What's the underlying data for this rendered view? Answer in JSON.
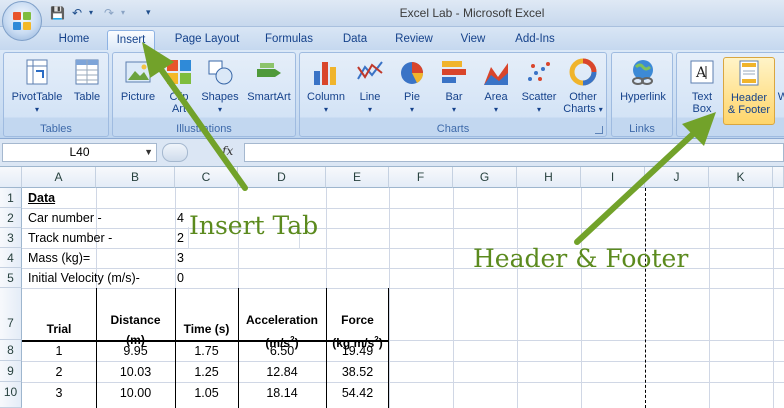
{
  "window": {
    "title": "Excel Lab - Microsoft Excel"
  },
  "quick_access": {
    "save_icon": "save-icon",
    "undo_icon": "undo-icon",
    "redo_icon": "redo-icon",
    "customize_icon": "customize-icon"
  },
  "tabs": [
    {
      "label": "Home"
    },
    {
      "label": "Insert"
    },
    {
      "label": "Page Layout"
    },
    {
      "label": "Formulas"
    },
    {
      "label": "Data"
    },
    {
      "label": "Review"
    },
    {
      "label": "View"
    },
    {
      "label": "Add-Ins"
    }
  ],
  "ribbon": {
    "groups": {
      "tables": "Tables",
      "illustrations": "Illustrations",
      "charts": "Charts",
      "links": "Links"
    },
    "buttons": {
      "pivottable": "PivotTable",
      "table": "Table",
      "picture": "Picture",
      "clipart_1": "Clip",
      "clipart_2": "Art",
      "shapes": "Shapes",
      "smartart": "SmartArt",
      "column": "Column",
      "line": "Line",
      "pie": "Pie",
      "bar": "Bar",
      "area": "Area",
      "scatter": "Scatter",
      "other_1": "Other",
      "other_2": "Charts",
      "hyperlink": "Hyperlink",
      "textbox_1": "Text",
      "textbox_2": "Box",
      "headerfooter_1": "Header",
      "headerfooter_2": "& Footer",
      "wordart_partial": "W"
    }
  },
  "formula_bar": {
    "name_box": "L40",
    "fx": "fx",
    "formula": ""
  },
  "columns": [
    "A",
    "B",
    "C",
    "D",
    "E",
    "F",
    "G",
    "H",
    "I",
    "J",
    "K"
  ],
  "rows": [
    "1",
    "2",
    "3",
    "4",
    "5",
    "7",
    "8",
    "9",
    "10"
  ],
  "sheet": {
    "data_title": "Data",
    "params": [
      {
        "label": "Car number -",
        "value": "4"
      },
      {
        "label": "Track number -",
        "value": "2"
      },
      {
        "label": "Mass (kg)=",
        "value": "3"
      },
      {
        "label": "Initial Velocity (m/s)-",
        "value": "0"
      }
    ],
    "headers": {
      "trial": "Trial",
      "distance_1": "Distance",
      "distance_2": "(m)",
      "time": "Time (s)",
      "accel_1": "Acceleration",
      "accel_2": "(m/s",
      "accel_sup": "2",
      "accel_3": ")",
      "force_1": "Force",
      "force_2": "(kg m/s",
      "force_sup": "2",
      "force_3": ")"
    },
    "table": [
      [
        "1",
        "9.95",
        "1.75",
        "6.50",
        "19.49"
      ],
      [
        "2",
        "10.03",
        "1.25",
        "12.84",
        "38.52"
      ],
      [
        "3",
        "10.00",
        "1.05",
        "18.14",
        "54.42"
      ]
    ]
  },
  "annotations": {
    "insert_tab": "Insert Tab",
    "header_footer": "Header & Footer"
  },
  "colors": {
    "annotation": "#5b8a1e",
    "ribbon": "#c9dcf2",
    "accent": "#15428b"
  }
}
